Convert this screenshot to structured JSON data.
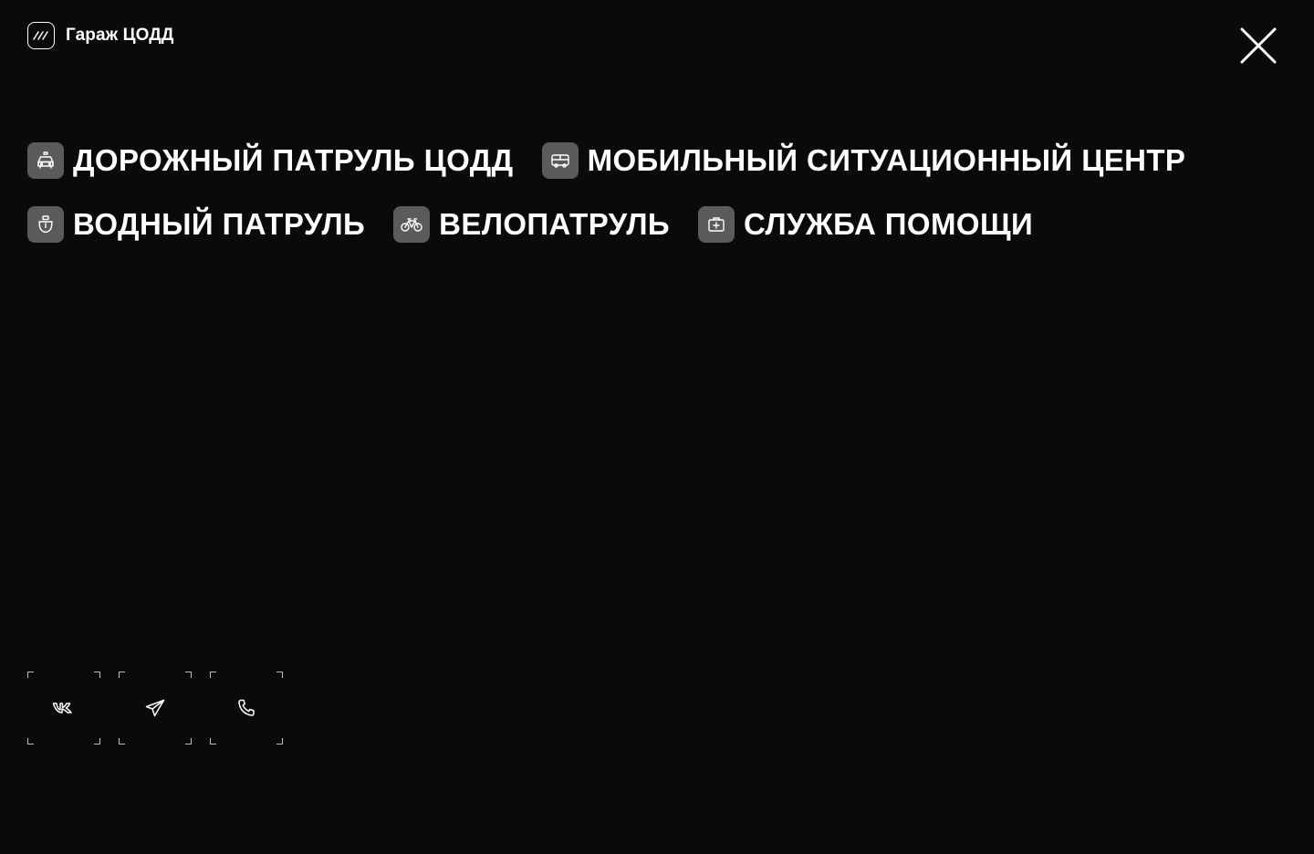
{
  "header": {
    "logo_text": "Гараж ЦОДД",
    "logo_icon": "slashes-logo-icon",
    "close_icon": "close-icon"
  },
  "nav": {
    "rows": [
      [
        {
          "label": "Дорожный патруль ЦОДД",
          "icon": "car-icon"
        },
        {
          "label": "Мобильный ситуационный центр",
          "icon": "bus-icon"
        }
      ],
      [
        {
          "label": "Водный патруль",
          "icon": "boat-icon"
        },
        {
          "label": "Велопатруль",
          "icon": "bicycle-icon"
        },
        {
          "label": "Служба помощи",
          "icon": "first-aid-kit-icon"
        }
      ]
    ]
  },
  "socials": [
    {
      "icon": "vk-icon"
    },
    {
      "icon": "telegram-icon"
    },
    {
      "icon": "phone-icon"
    }
  ],
  "colors": {
    "background": "#0a0a0a",
    "text": "#ffffff",
    "icon_tile": "#5b5b5b",
    "corner_marks": "#bdbdbd"
  }
}
